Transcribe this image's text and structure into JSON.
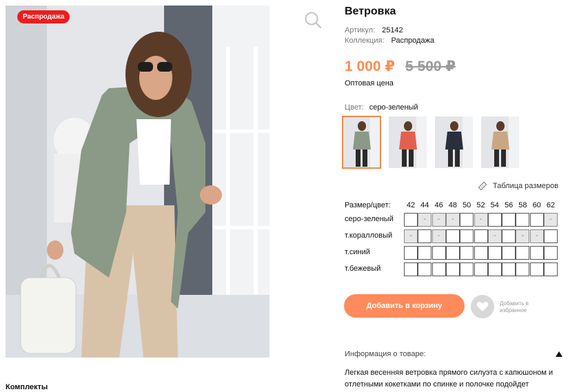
{
  "badge": "Распродажа",
  "product": {
    "title": "Ветровка",
    "article_label": "Артикул:",
    "article_value": "25142",
    "collection_label": "Коллекция:",
    "collection_value": "Распродажа",
    "price": "1 000 ₽",
    "old_price": "5 500 ₽",
    "price_note": "Оптовая цена",
    "color_label": "Цвет:",
    "color_value": "серо-зеленый"
  },
  "thumbnails": [
    {
      "name": "серо-зеленый",
      "coat": "#8a9a86",
      "active": true
    },
    {
      "name": "т.коралловый",
      "coat": "#e2604e",
      "active": false
    },
    {
      "name": "т.синий",
      "coat": "#2a2f3d",
      "active": false
    },
    {
      "name": "т.бежевый",
      "coat": "#c9a784",
      "active": false
    }
  ],
  "size_table_link": "Таблица размеров",
  "size_grid": {
    "header_label": "Размер/цвет:",
    "sizes": [
      "42",
      "44",
      "46",
      "48",
      "50",
      "52",
      "54",
      "56",
      "58",
      "60",
      "62"
    ],
    "rows": [
      {
        "color": "серо-зеленый",
        "cells": [
          "",
          "-",
          "-",
          "-",
          "",
          "-",
          "",
          "",
          "",
          "",
          "-"
        ]
      },
      {
        "color": "т.коралловый",
        "cells": [
          "-",
          "",
          "-",
          "",
          "",
          "",
          "-",
          "",
          "-",
          "-",
          ""
        ]
      },
      {
        "color": "т.синий",
        "cells": [
          "",
          "",
          "",
          "",
          "",
          "",
          "",
          "",
          "",
          "",
          ""
        ]
      },
      {
        "color": "т.бежевый",
        "cells": [
          "",
          "",
          "",
          "",
          "",
          "",
          "",
          "",
          "",
          "",
          ""
        ]
      }
    ]
  },
  "add_to_cart": "Добавить в корзину",
  "favorite_label": "Добавить в избранное",
  "info_header": "Информация о товаре:",
  "description": "Легкая весенняя ветровка прямого силуэта с капюшоном и отлетными кокетками по спинке и полочке подойдет",
  "kits_label": "Комплекты",
  "colors": {
    "accent": "#ff8a5b",
    "price": "#ff8a50",
    "sale": "#ee1c1c"
  }
}
